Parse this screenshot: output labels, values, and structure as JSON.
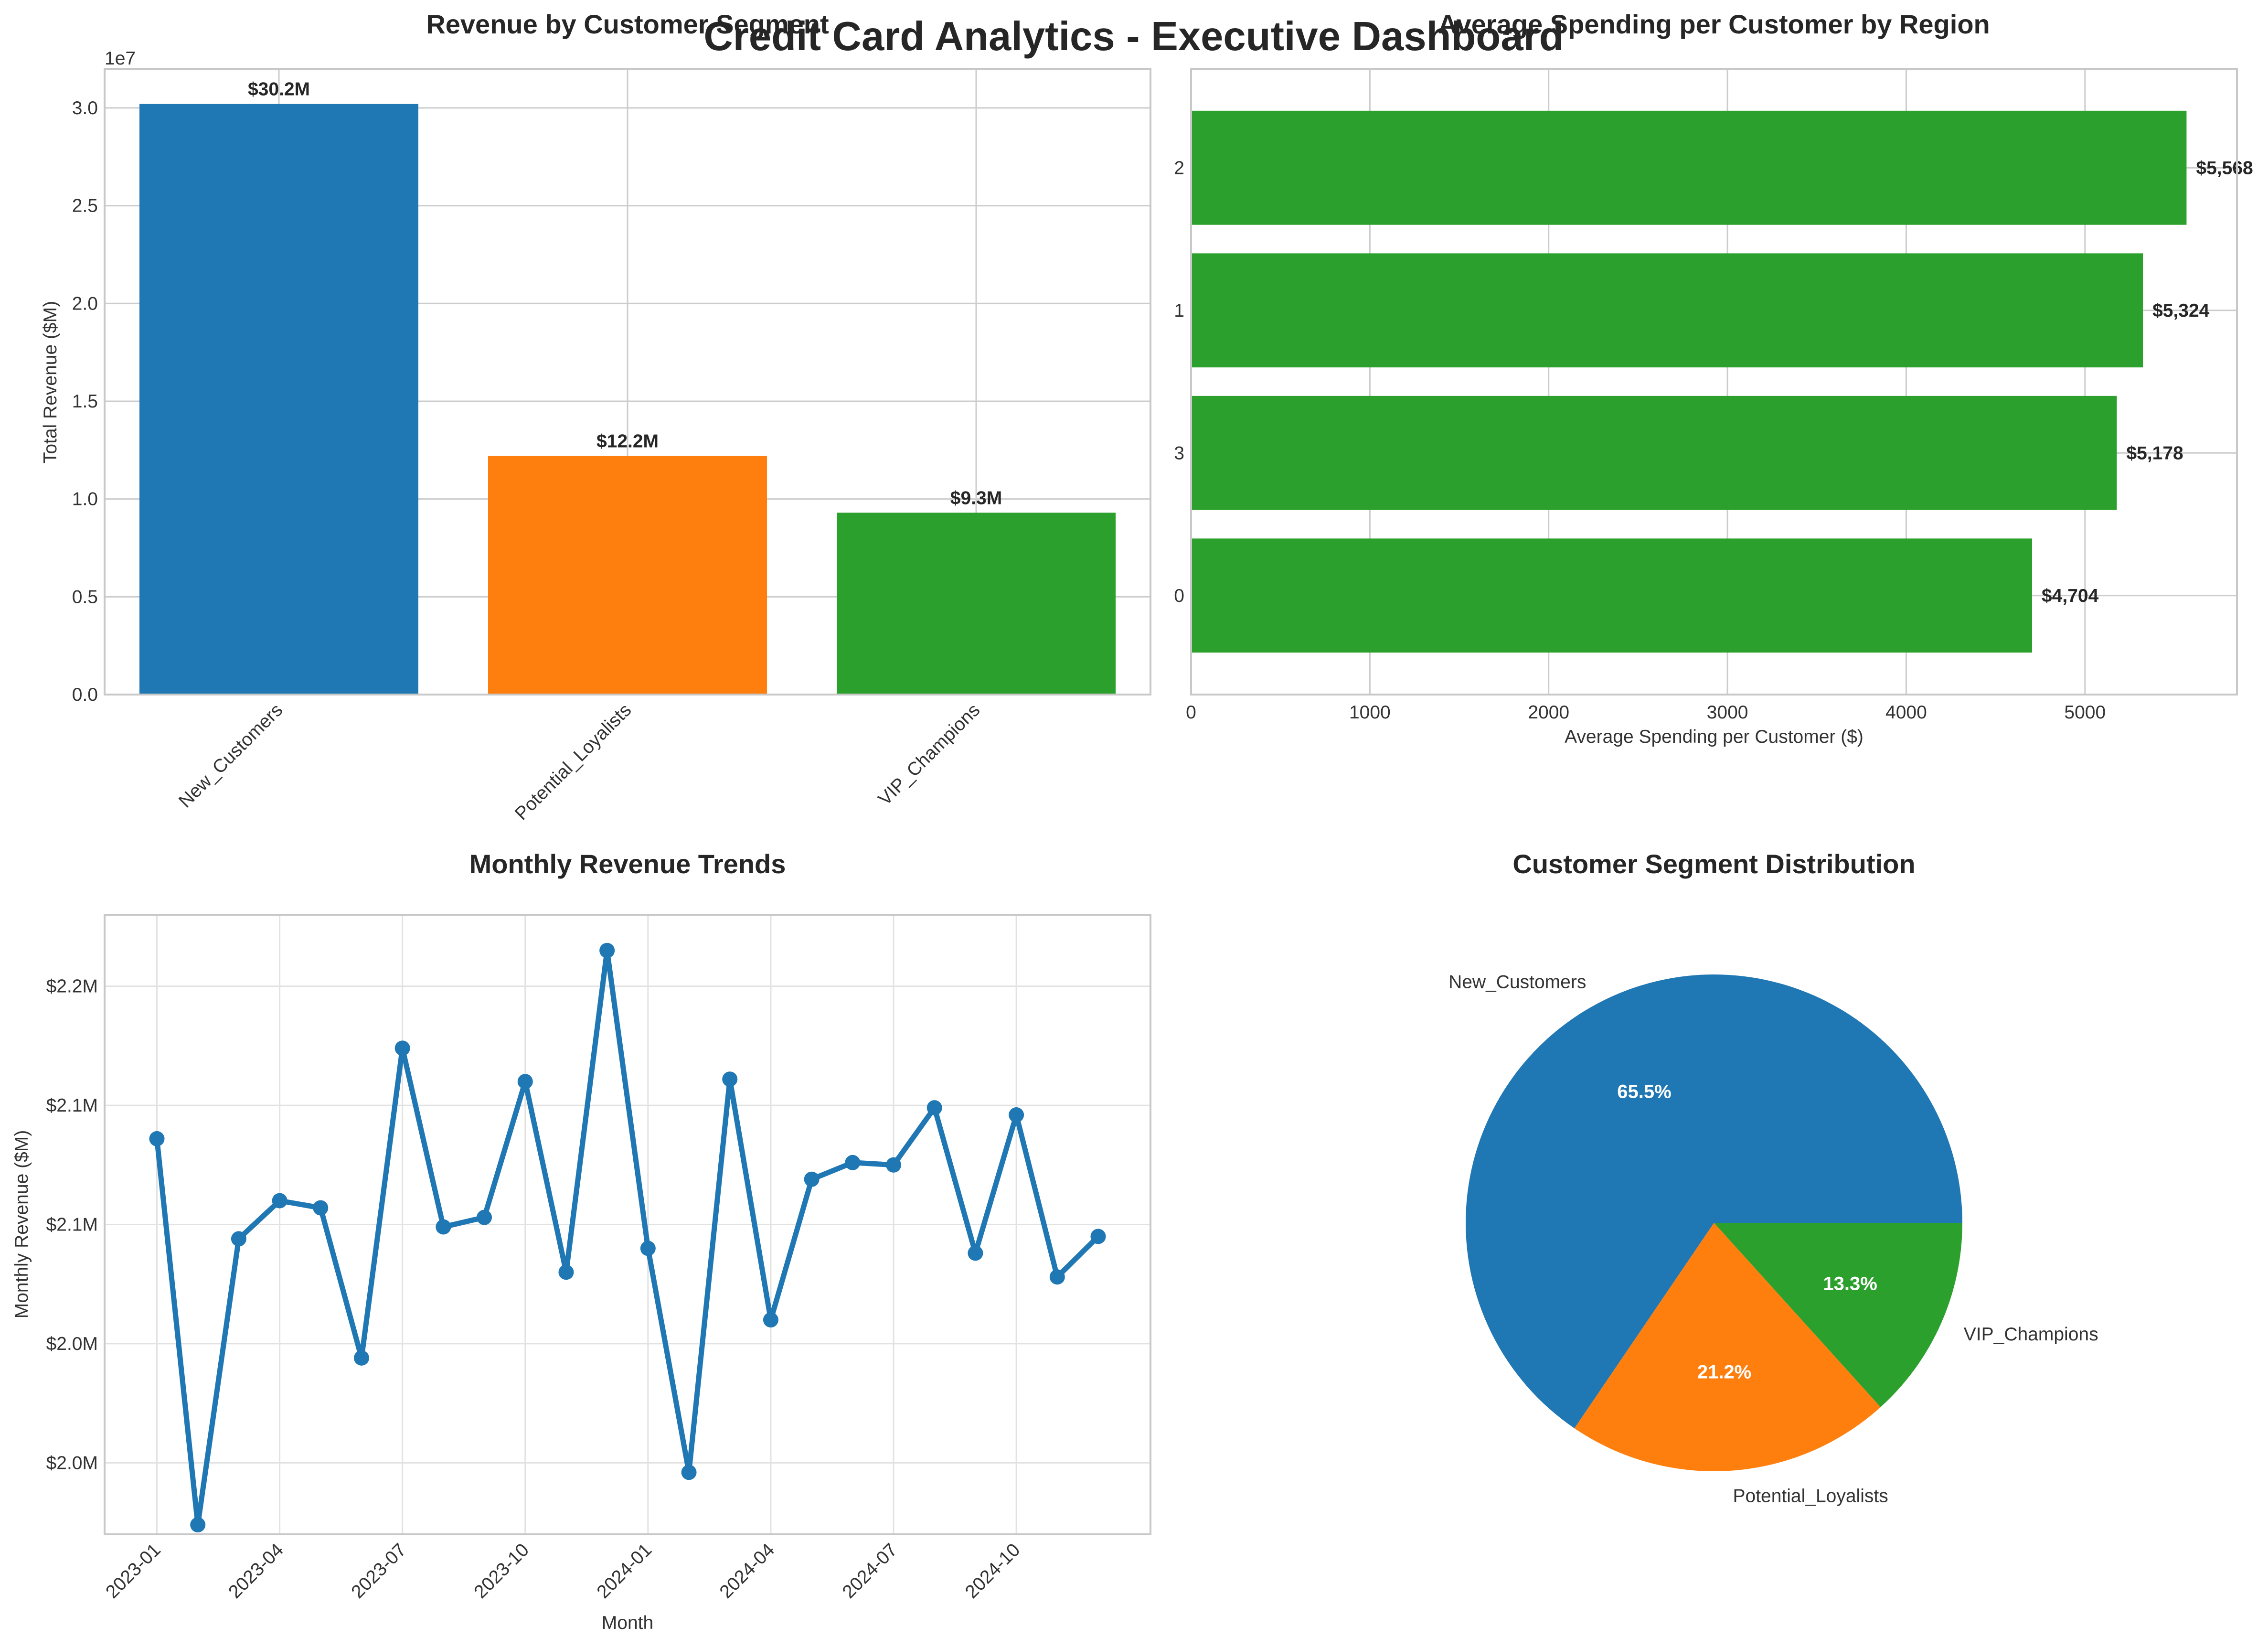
{
  "suptitle": "Credit Card Analytics - Executive Dashboard",
  "colors": {
    "blue": "#1f77b4",
    "orange": "#ff7f0e",
    "green": "#2ca02c"
  },
  "chart_data": [
    {
      "type": "bar",
      "title": "Revenue by Customer Segment",
      "xlabel": "",
      "ylabel": "Total Revenue ($M)",
      "offset_text": "1e7",
      "categories": [
        "New_Customers",
        "Potential_Loyalists",
        "VIP_Champions"
      ],
      "values": [
        30200000,
        12200000,
        9300000
      ],
      "bar_labels": [
        "$30.2M",
        "$12.2M",
        "$9.3M"
      ],
      "colors": [
        "#1f77b4",
        "#ff7f0e",
        "#2ca02c"
      ],
      "ylim": [
        0,
        32000000
      ],
      "yticks": [
        0,
        5000000,
        10000000,
        15000000,
        20000000,
        25000000,
        30000000
      ],
      "ytick_labels": [
        "0.0",
        "0.5",
        "1.0",
        "1.5",
        "2.0",
        "2.5",
        "3.0"
      ],
      "grid": true
    },
    {
      "type": "bar",
      "orientation": "horizontal",
      "title": "Average Spending per Customer by Region",
      "xlabel": "Average Spending per Customer ($)",
      "ylabel": "",
      "categories": [
        "2",
        "1",
        "3",
        "0"
      ],
      "values": [
        5568,
        5324,
        5178,
        4704
      ],
      "bar_labels": [
        "$5,568",
        "$5,324",
        "$5,178",
        "$4,704"
      ],
      "color": "#2ca02c",
      "xlim": [
        0,
        5850
      ],
      "xticks": [
        0,
        1000,
        2000,
        3000,
        4000,
        5000
      ],
      "xtick_labels": [
        "0",
        "1000",
        "2000",
        "3000",
        "4000",
        "5000"
      ],
      "grid": true
    },
    {
      "type": "line",
      "title": "Monthly Revenue Trends",
      "xlabel": "Month",
      "ylabel": "Monthly Revenue ($M)",
      "x": [
        "2023-01",
        "2023-02",
        "2023-03",
        "2023-04",
        "2023-05",
        "2023-06",
        "2023-07",
        "2023-08",
        "2023-09",
        "2023-10",
        "2023-11",
        "2023-12",
        "2024-01",
        "2024-02",
        "2024-03",
        "2024-04",
        "2024-05",
        "2024-06",
        "2024-07",
        "2024-08",
        "2024-09",
        "2024-10",
        "2024-11",
        "2024-12"
      ],
      "values": [
        2136000,
        1974000,
        2094000,
        2110000,
        2107000,
        2044000,
        2174000,
        2099000,
        2103000,
        2160000,
        2080000,
        2215000,
        2090000,
        1996000,
        2161000,
        2060000,
        2119000,
        2126000,
        2125000,
        2149000,
        2088000,
        2146000,
        2078000,
        2095000
      ],
      "ylim": [
        1970000,
        2230000
      ],
      "yticks": [
        2000000,
        2050000,
        2100000,
        2150000,
        2200000
      ],
      "ytick_labels": [
        "$2.0M",
        "$2.0M",
        "$2.1M",
        "$2.1M",
        "$2.2M"
      ],
      "xticks": [
        "2023-01",
        "2023-04",
        "2023-07",
        "2023-10",
        "2024-01",
        "2024-04",
        "2024-07",
        "2024-10"
      ],
      "color": "#1f77b4",
      "grid": true
    },
    {
      "type": "pie",
      "title": "Customer Segment Distribution",
      "labels": [
        "New_Customers",
        "Potential_Loyalists",
        "VIP_Champions"
      ],
      "values": [
        65.5,
        21.2,
        13.3
      ],
      "pct_labels": [
        "65.5%",
        "21.2%",
        "13.3%"
      ],
      "colors": [
        "#1f77b4",
        "#ff7f0e",
        "#2ca02c"
      ]
    }
  ]
}
